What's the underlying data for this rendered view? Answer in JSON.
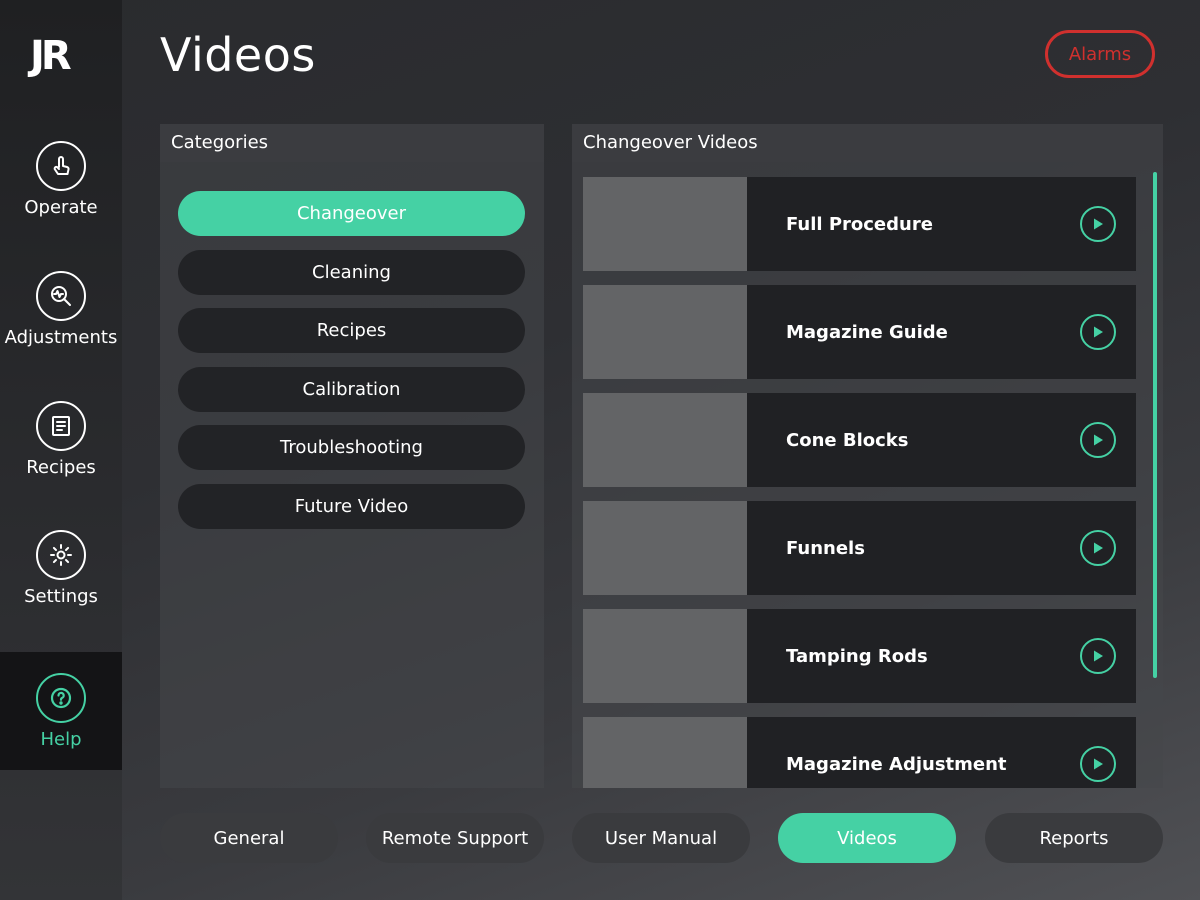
{
  "brand": {
    "logo_text": "JR"
  },
  "header": {
    "title": "Videos",
    "alarms_label": "Alarms"
  },
  "colors": {
    "accent": "#45d1a4",
    "alarm": "#d0302e",
    "panel_header": "#3b3c40",
    "row_bg": "#202124",
    "thumb": "#636466"
  },
  "sidebar": {
    "items": [
      {
        "label": "Operate",
        "icon": "touch-icon",
        "active": false
      },
      {
        "label": "Adjustments",
        "icon": "magnifier-pulse-icon",
        "active": false
      },
      {
        "label": "Recipes",
        "icon": "document-list-icon",
        "active": false
      },
      {
        "label": "Settings",
        "icon": "gear-icon",
        "active": false
      },
      {
        "label": "Help",
        "icon": "question-icon",
        "active": true
      }
    ]
  },
  "categories": {
    "header": "Categories",
    "items": [
      {
        "label": "Changeover",
        "active": true
      },
      {
        "label": "Cleaning",
        "active": false
      },
      {
        "label": "Recipes",
        "active": false
      },
      {
        "label": "Calibration",
        "active": false
      },
      {
        "label": "Troubleshooting",
        "active": false
      },
      {
        "label": "Future Video",
        "active": false
      }
    ]
  },
  "videos": {
    "header": "Changeover Videos",
    "items": [
      {
        "title": "Full Procedure"
      },
      {
        "title": "Magazine Guide"
      },
      {
        "title": "Cone Blocks"
      },
      {
        "title": "Funnels"
      },
      {
        "title": "Tamping Rods"
      },
      {
        "title": "Magazine Adjustment"
      }
    ]
  },
  "bottom_tabs": [
    {
      "label": "General",
      "active": false
    },
    {
      "label": "Remote Support",
      "active": false
    },
    {
      "label": "User Manual",
      "active": false
    },
    {
      "label": "Videos",
      "active": true
    },
    {
      "label": "Reports",
      "active": false
    }
  ]
}
